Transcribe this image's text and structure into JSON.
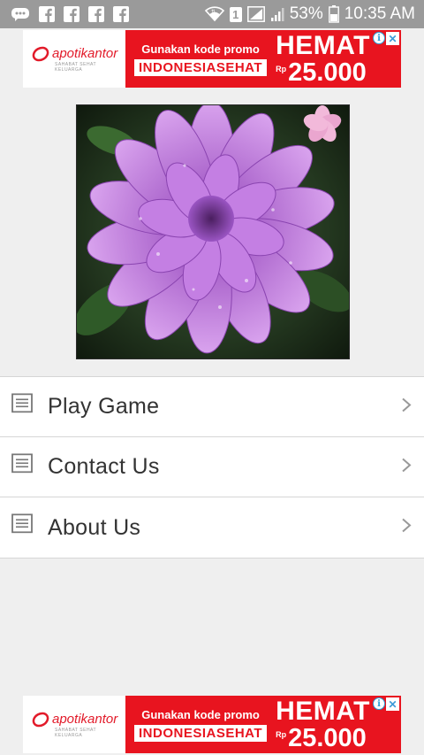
{
  "status_bar": {
    "battery_percent": "53%",
    "sim_label": "1",
    "time": "10:35 AM",
    "notification_icons": [
      "chat-icon",
      "facebook-icon",
      "facebook-icon",
      "facebook-icon",
      "facebook-icon"
    ]
  },
  "ads": [
    {
      "brand": "apotikantor",
      "tagline": "SAHABAT SEHAT KELUARGA",
      "promo_text": "Gunakan kode promo",
      "promo_code": "INDONESIASEHAT",
      "headline": "HEMAT",
      "currency": "Rp",
      "price": "25.000",
      "brand_color": "#e8141f"
    },
    {
      "brand": "apotikantor",
      "tagline": "SAHABAT SEHAT KELUARGA",
      "promo_text": "Gunakan kode promo",
      "promo_code": "INDONESIASEHAT",
      "headline": "HEMAT",
      "currency": "Rp",
      "price": "25.000",
      "brand_color": "#e8141f"
    }
  ],
  "menu": {
    "items": [
      {
        "label": "Play Game",
        "icon": "list-document-icon"
      },
      {
        "label": "Contact Us",
        "icon": "list-document-icon"
      },
      {
        "label": "About Us",
        "icon": "list-document-icon"
      }
    ]
  },
  "colors": {
    "status_bar_bg": "#9a9a9a",
    "page_bg": "#efefef",
    "ad_red": "#e8141f",
    "flower_purple": "#b96fd6"
  }
}
